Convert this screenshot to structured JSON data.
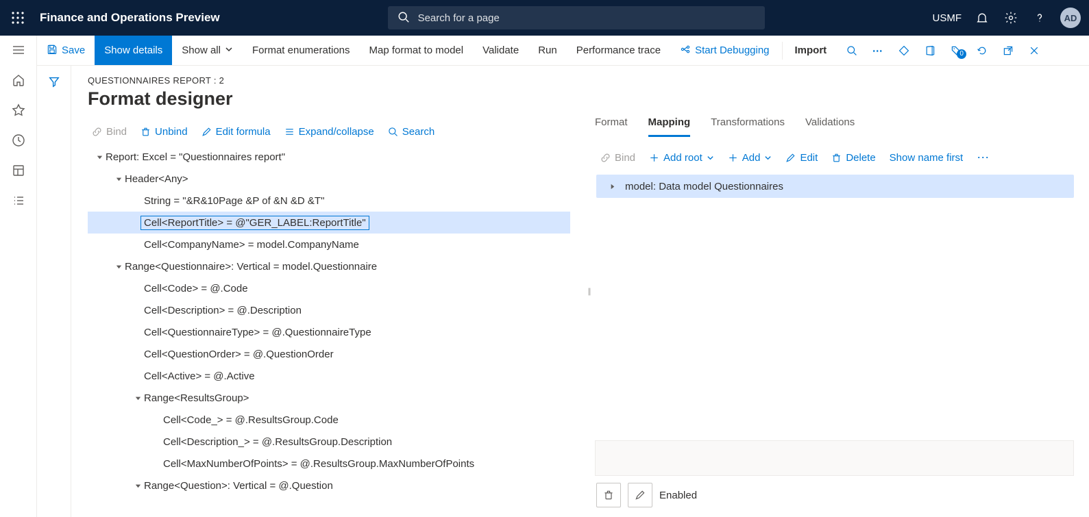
{
  "header": {
    "product_title": "Finance and Operations Preview",
    "search_placeholder": "Search for a page",
    "company": "USMF",
    "avatar_initials": "AD"
  },
  "actionbar": {
    "save": "Save",
    "show_details": "Show details",
    "show_all": "Show all",
    "format_enumerations": "Format enumerations",
    "map_format_to_model": "Map format to model",
    "validate": "Validate",
    "run": "Run",
    "performance_trace": "Performance trace",
    "start_debugging": "Start Debugging",
    "import": "Import",
    "badge_count": "0"
  },
  "page": {
    "breadcrumb": "QUESTIONNAIRES REPORT : 2",
    "title": "Format designer"
  },
  "tree_toolbar": {
    "bind": "Bind",
    "unbind": "Unbind",
    "edit_formula": "Edit formula",
    "expand_collapse": "Expand/collapse",
    "search": "Search"
  },
  "tree": {
    "nodes": [
      {
        "depth": 0,
        "caret": "down",
        "label": "Report: Excel = \"Questionnaires report\""
      },
      {
        "depth": 1,
        "caret": "down",
        "label": "Header<Any>"
      },
      {
        "depth": 2,
        "caret": "none",
        "label": "String = \"&R&10Page &P of &N &D &T\""
      },
      {
        "depth": 2,
        "caret": "none",
        "label": "Cell<ReportTitle> = @\"GER_LABEL:ReportTitle\"",
        "selected": true
      },
      {
        "depth": 2,
        "caret": "none",
        "label": "Cell<CompanyName> = model.CompanyName"
      },
      {
        "depth": 1,
        "caret": "down",
        "label": "Range<Questionnaire>: Vertical = model.Questionnaire"
      },
      {
        "depth": 2,
        "caret": "none",
        "label": "Cell<Code> = @.Code"
      },
      {
        "depth": 2,
        "caret": "none",
        "label": "Cell<Description> = @.Description"
      },
      {
        "depth": 2,
        "caret": "none",
        "label": "Cell<QuestionnaireType> = @.QuestionnaireType"
      },
      {
        "depth": 2,
        "caret": "none",
        "label": "Cell<QuestionOrder> = @.QuestionOrder"
      },
      {
        "depth": 2,
        "caret": "none",
        "label": "Cell<Active> = @.Active"
      },
      {
        "depth": 2,
        "caret": "down",
        "label": "Range<ResultsGroup>"
      },
      {
        "depth": 3,
        "caret": "none",
        "label": "Cell<Code_> = @.ResultsGroup.Code"
      },
      {
        "depth": 3,
        "caret": "none",
        "label": "Cell<Description_> = @.ResultsGroup.Description"
      },
      {
        "depth": 3,
        "caret": "none",
        "label": "Cell<MaxNumberOfPoints> = @.ResultsGroup.MaxNumberOfPoints"
      },
      {
        "depth": 2,
        "caret": "down",
        "label": "Range<Question>: Vertical = @.Question"
      }
    ]
  },
  "tabs": {
    "format": "Format",
    "mapping": "Mapping",
    "transformations": "Transformations",
    "validations": "Validations"
  },
  "map_toolbar": {
    "bind": "Bind",
    "add_root": "Add root",
    "add": "Add",
    "edit": "Edit",
    "delete": "Delete",
    "show_name_first": "Show name first"
  },
  "mapping_row": "model: Data model Questionnaires",
  "footer": {
    "enabled": "Enabled"
  }
}
